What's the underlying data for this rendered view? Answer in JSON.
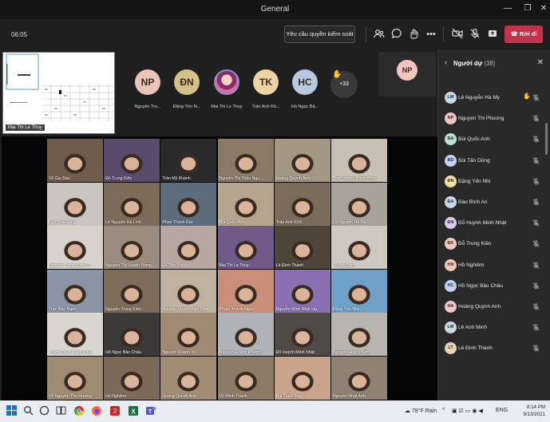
{
  "window": {
    "title": "General"
  },
  "meeting": {
    "timer": "06:05",
    "admit_label": "Yêu cầu quyền kiểm soát",
    "leave_label": "Rời đi"
  },
  "share": {
    "presenter_label": "Mai Thi Le Thuy"
  },
  "strip": {
    "avatars": [
      {
        "initials": "NP",
        "name": "Nguyễn Trọ...",
        "color": "#e8c5b8"
      },
      {
        "initials": "ĐN",
        "name": "Đặng Yến N...",
        "color": "#d4c089"
      },
      {
        "initials": "",
        "name": "Mai Thi Le Thuy",
        "color": "#c58a6a"
      },
      {
        "initials": "TK",
        "name": "Trần Anh Kh...",
        "color": "#ecd3a4"
      },
      {
        "initials": "HC",
        "name": "Hồ Ngọc Bả...",
        "color": "#b7c9de"
      }
    ],
    "more_count": "+33",
    "pip_initials": "NP"
  },
  "grid": {
    "tiles": [
      "Võ Gia Bảo",
      "Đỗ Trung Kiên",
      "Trần Mỹ Khánh",
      "Nguyễn Thị Thảo Ngu...",
      "Hoàng Quỳnh Anh",
      "Trần Hoàng Đăng Khoa",
      "Ngô Thế Hùng",
      "Lê Nguyễn Hà Linh",
      "Phan Thành Đạt",
      "Bùi Quốc Anh",
      "Trần Anh Khôi",
      "Lê Nguyễn Hà My",
      "Nguyễn Trọng Minh P...",
      "Nguyễn Thị Huyền Trang",
      "Lê Thái Bảo",
      "Mai Thi Le Thuy",
      "Lê Đình Thành",
      "Lê Anh Minh",
      "Trần Bảo Nam",
      "Nguyễn Trung Kiên",
      "Nguyễn Huỳnh Bảo Trân",
      "Phạm Khánh Ngọc",
      "Nguyễn Minh Nhật Hạ",
      "Đặng Yến Nhi",
      "Phạm Danh Đăng Khoa",
      "Hồ Ngọc Bảo Châu",
      "Nguyễn Khánh Vy",
      "Nguyễn Hoàng Phươn...",
      "Đỗ Huỳnh Minh Nhật",
      "Nguyễn Hoàng Sơn",
      "Võ Nguyễn Thu Hương",
      "Hồ Nghiêm",
      "Hoàng Quỳnh Anh",
      "Vũ Minh Thành",
      "Bùi Tấn Dũng",
      "Nguyễn Nhật Anh"
    ],
    "colors": [
      "#6e5b4c",
      "#5a4a6b",
      "#2a2a2a",
      "#8b7a66",
      "#a39884",
      "#c7c0b3",
      "#c9c6c2",
      "#7d6a58",
      "#5d6d7e",
      "#b5a48e",
      "#7a6b5a",
      "#a8a29a",
      "#d6d2cc",
      "#9a8d7e",
      "#b8a7a0",
      "#6f5a8a",
      "#4e4438",
      "#cfc8c0",
      "#8a94a6",
      "#7e6c5a",
      "#c0b2a0",
      "#c98f78",
      "#8a6fb3",
      "#6fa0c8",
      "#d9d5cf",
      "#3c3a38",
      "#a08a74",
      "#b0b4b8",
      "#4f4a45",
      "#b8b4ae",
      "#9f8b74",
      "#7b6a58",
      "#a18c76",
      "#8c7b66",
      "#c9a48a",
      "#8f8272"
    ]
  },
  "panel": {
    "title": "Người dự",
    "count": "(38)",
    "people": [
      {
        "initials": "LM",
        "name": "Lê Nguyễn Hà My",
        "color": "#c8d8e6",
        "hand": true
      },
      {
        "initials": "NP",
        "name": "Nguyen Thi Phuong",
        "color": "#f2c6c0",
        "hand": false
      },
      {
        "initials": "BA",
        "name": "Bùi Quốc Anh",
        "color": "#bfe0d8",
        "hand": false
      },
      {
        "initials": "BD",
        "name": "Bùi Tấn Dũng",
        "color": "#c6d3f0",
        "hand": false
      },
      {
        "initials": "ĐN",
        "name": "Đặng Yến Nhi",
        "color": "#f3dea4",
        "hand": false
      },
      {
        "initials": "ĐA",
        "name": "Đào Bình An",
        "color": "#c9d7ee",
        "hand": false
      },
      {
        "initials": "ĐN",
        "name": "Đỗ Huỳnh Minh Nhật",
        "color": "#d7cbe8",
        "hand": false
      },
      {
        "initials": "ĐK",
        "name": "Đỗ Trung Kiên",
        "color": "#f1c9b8",
        "hand": false
      },
      {
        "initials": "HN",
        "name": "Hồ Nghiêm",
        "color": "#f2c8b5",
        "hand": false
      },
      {
        "initials": "HC",
        "name": "Hồ Ngọc Bảo Châu",
        "color": "#c3d4ee",
        "hand": false
      },
      {
        "initials": "HA",
        "name": "Hoàng Quỳnh Anh",
        "color": "#f0c7c7",
        "hand": false
      },
      {
        "initials": "LM",
        "name": "Lê Anh Minh",
        "color": "#c8dce3",
        "hand": false
      },
      {
        "initials": "LT",
        "name": "Lê Đình Thành",
        "color": "#e9d3b7",
        "hand": false
      }
    ]
  },
  "taskbar": {
    "weather": "78°F Rain",
    "lang": "ENG",
    "time": "8:14 PM",
    "date": "9/13/2021"
  }
}
